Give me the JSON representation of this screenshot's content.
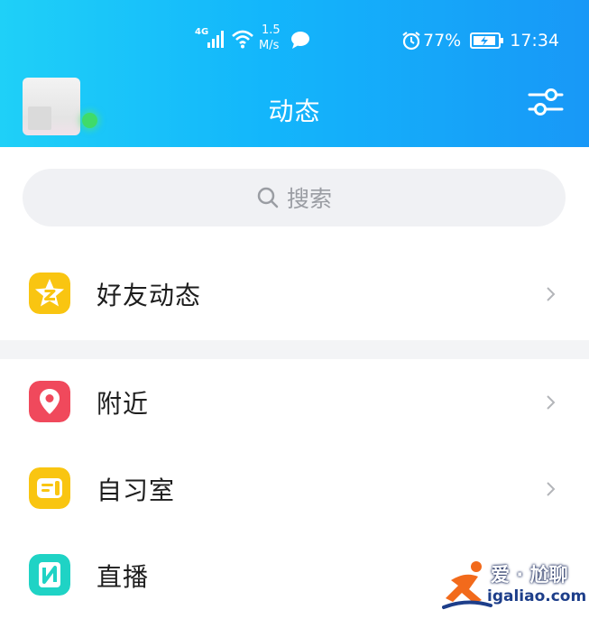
{
  "status_bar": {
    "network": "4G",
    "speed_value": "1.5",
    "speed_unit": "M/s",
    "battery": "77%",
    "time": "17:34",
    "icons": [
      "signal-icon",
      "wifi-icon",
      "message-bubble-icon",
      "alarm-icon",
      "battery-charging-icon"
    ]
  },
  "header": {
    "title": "动态",
    "filter_icon": "sliders-icon"
  },
  "search": {
    "placeholder": "搜索",
    "icon": "search-icon"
  },
  "menu": {
    "items": [
      {
        "label": "好友动态",
        "icon": "qzone-star-icon",
        "color": "#f9c511"
      },
      {
        "label": "附近",
        "icon": "location-pin-icon",
        "color": "#f0495c"
      },
      {
        "label": "自习室",
        "icon": "study-room-icon",
        "color": "#f9c511"
      },
      {
        "label": "直播",
        "icon": "live-icon",
        "color": "#1fd3c5"
      }
    ]
  },
  "watermark": {
    "top": "爱 · 尬聊",
    "bottom": "igaliao.com"
  },
  "colors": {
    "header_start": "#1fd0f8",
    "header_end": "#1898f7",
    "online": "#3fdb6a"
  }
}
